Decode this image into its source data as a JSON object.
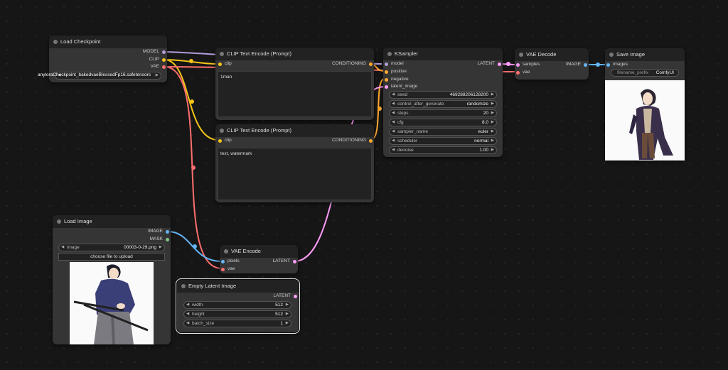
{
  "colors": {
    "model": "#b39ddb",
    "clip": "#f5c518",
    "vae": "#ff6e6e",
    "conditioning": "#ffa931",
    "latent": "#ff9cf9",
    "image": "#64b5f6",
    "mask": "#81c784"
  },
  "load_checkpoint": {
    "title": "Load Checkpoint",
    "outputs": [
      "MODEL",
      "CLIP",
      "VAE"
    ],
    "ckpt_overlay": "anyloraCheckpoint_bakedvaeBlessedFp16.safetensors",
    "ckpt_name_label": "ckpt_name"
  },
  "clip_pos": {
    "title": "CLIP Text Encode (Prompt)",
    "input": "clip",
    "output": "CONDITIONING",
    "text": "1man"
  },
  "clip_neg": {
    "title": "CLIP Text Encode (Prompt)",
    "input": "clip",
    "output": "CONDITIONING",
    "text": "text, watermark"
  },
  "ksampler": {
    "title": "KSampler",
    "inputs": [
      "model",
      "positive",
      "negative",
      "latent_image"
    ],
    "output": "LATENT",
    "widgets": [
      {
        "label": "seed",
        "value": "469288206128200"
      },
      {
        "label": "control_after_generate",
        "value": "randomize"
      },
      {
        "label": "steps",
        "value": "20"
      },
      {
        "label": "cfg",
        "value": "8.0"
      },
      {
        "label": "sampler_name",
        "value": "euler"
      },
      {
        "label": "scheduler",
        "value": "normal"
      },
      {
        "label": "denoise",
        "value": "1.00"
      }
    ]
  },
  "vae_decode": {
    "title": "VAE Decode",
    "inputs": [
      "samples",
      "vae"
    ],
    "output": "IMAGE"
  },
  "save_image": {
    "title": "Save Image",
    "input": "images",
    "prefix_label": "filename_prefix",
    "prefix_value": "ComfyUI"
  },
  "load_image": {
    "title": "Load Image",
    "outputs": [
      "IMAGE",
      "MASK"
    ],
    "image_label": "image",
    "image_value": "00003-0-29.png",
    "upload_label": "choose file to upload"
  },
  "vae_encode": {
    "title": "VAE Encode",
    "inputs": [
      "pixels",
      "vae"
    ],
    "output": "LATENT"
  },
  "empty_latent": {
    "title": "Empty Latent Image",
    "output": "LATENT",
    "widgets": [
      {
        "label": "width",
        "value": "512"
      },
      {
        "label": "height",
        "value": "512"
      },
      {
        "label": "batch_size",
        "value": "1"
      }
    ]
  }
}
